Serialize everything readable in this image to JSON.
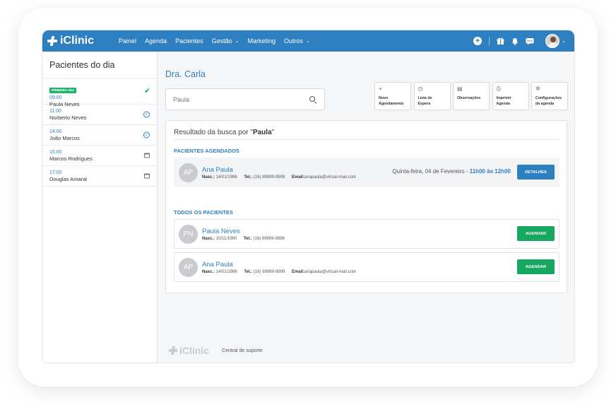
{
  "app": {
    "logo_text": "iClinic"
  },
  "nav": {
    "items": [
      {
        "label": "Painel",
        "dropdown": false
      },
      {
        "label": "Agenda",
        "dropdown": false
      },
      {
        "label": "Pacientes",
        "dropdown": false
      },
      {
        "label": "Gestão",
        "dropdown": true
      },
      {
        "label": "Marketing",
        "dropdown": false
      },
      {
        "label": "Outros",
        "dropdown": true
      }
    ],
    "icons": [
      "add-circle-icon",
      "gift-icon",
      "bell-icon",
      "chat-icon"
    ],
    "chevron": "⌄",
    "plus": "+"
  },
  "sidebar": {
    "title": "Pacientes do dia",
    "patients": [
      {
        "badge": "PRIMEIRA VEZ",
        "time": "09:00",
        "name": "Paula Neves",
        "status": "checked",
        "status_glyph": "✔"
      },
      {
        "badge": "",
        "time": "11:00",
        "name": "Norberto Neves",
        "status": "confirmed",
        "status_glyph": "✓"
      },
      {
        "badge": "",
        "time": "14:00",
        "name": "João Marcos",
        "status": "confirmed",
        "status_glyph": "✓"
      },
      {
        "badge": "",
        "time": "15:00",
        "name": "Marcos Rodrigues",
        "status": "scheduled",
        "status_glyph": ""
      },
      {
        "badge": "",
        "time": "17:00",
        "name": "Douglas Amaral",
        "status": "scheduled",
        "status_glyph": ""
      }
    ]
  },
  "main": {
    "doctor": "Dra. Carla",
    "search": {
      "value": "Paula",
      "placeholder": ""
    },
    "actions": [
      {
        "icon": "+",
        "label_line1": "Novo",
        "label_line2": "Agendamento"
      },
      {
        "icon": "◷",
        "label_line1": "Lista de",
        "label_line2": "Espera"
      },
      {
        "icon": "▤",
        "label_line1": "Observações",
        "label_line2": ""
      },
      {
        "icon": "⎙",
        "label_line1": "Imprimir",
        "label_line2": "Agenda"
      },
      {
        "icon": "✲",
        "label_line1": "Configurações",
        "label_line2": "da agenda"
      }
    ],
    "results": {
      "title_prefix": "Resultado da busca por \"",
      "query": "Paula",
      "title_suffix": "\"",
      "scheduled_label": "PACIENTES AGENDADOS",
      "all_label": "TODOS OS PACIENTES",
      "labels": {
        "birth": "Nasc.:",
        "phone": "Tel.:",
        "email": "Email:"
      },
      "scheduled": [
        {
          "initials": "AP",
          "name": "Ana Paula",
          "birth": "14/01/1996",
          "phone": "(16) 99999-9999",
          "email": "anapaula@virtual-mail.com",
          "date": "Quinta-feira, 04 de Fevereiro - ",
          "time": "11h00 às 12h00",
          "button": "DETALHES"
        }
      ],
      "all": [
        {
          "initials": "PN",
          "name": "Paula Neves",
          "birth": "10/11/1960",
          "phone": "(16) 99999-9999",
          "email": "",
          "button": "AGENDAR"
        },
        {
          "initials": "AP",
          "name": "Ana Paula",
          "birth": "14/01/1996",
          "phone": "(16) 99999-9999",
          "email": "anapaula@virtual-mail.com",
          "button": "AGENDAR"
        }
      ]
    }
  },
  "footer": {
    "logo_text": "iClinic",
    "support_link": "Central de suporte"
  }
}
